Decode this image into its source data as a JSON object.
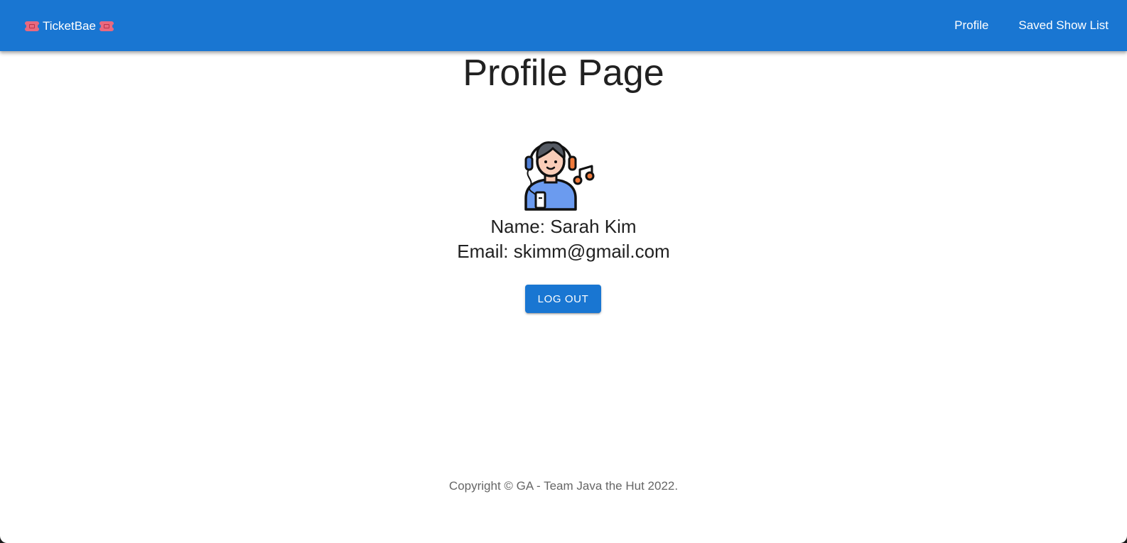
{
  "header": {
    "brand": "TicketBae",
    "brand_icon": "ticket-icon",
    "nav": [
      {
        "label": "Profile"
      },
      {
        "label": "Saved Show List"
      }
    ]
  },
  "main": {
    "title": "Profile Page",
    "avatar_icon": "listener-with-headphones-icon",
    "name_line": "Name: Sarah Kim",
    "email_line": "Email: skimm@gmail.com",
    "logout_label": "LOG OUT"
  },
  "footer": {
    "copyright": "Copyright © GA - Team Java the Hut 2022."
  },
  "colors": {
    "primary": "#1976d2",
    "ticket": "#e8697f"
  }
}
